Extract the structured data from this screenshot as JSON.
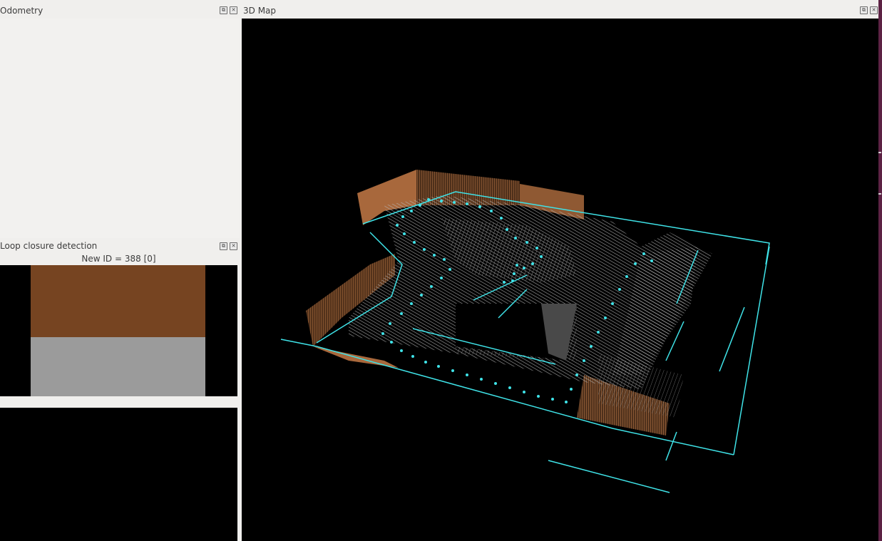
{
  "panels": {
    "odometry": {
      "title": "Odometry"
    },
    "map3d": {
      "title": "3D Map"
    },
    "loop_closure": {
      "title": "Loop closure detection",
      "new_id_text": "New ID = 388 [0]"
    }
  },
  "dock_buttons": {
    "float_glyph": "⧉",
    "close_glyph": "✕"
  },
  "colors": {
    "background": "#f0efed",
    "map_background": "#000000",
    "trajectory": "#3fe3e8",
    "cloud_gray": "#9a9a9a",
    "wall_brown": "#a8683c",
    "loop_brown": "#764421",
    "loop_gray": "#9b9b9b",
    "desktop_edge": "#5c2244"
  }
}
